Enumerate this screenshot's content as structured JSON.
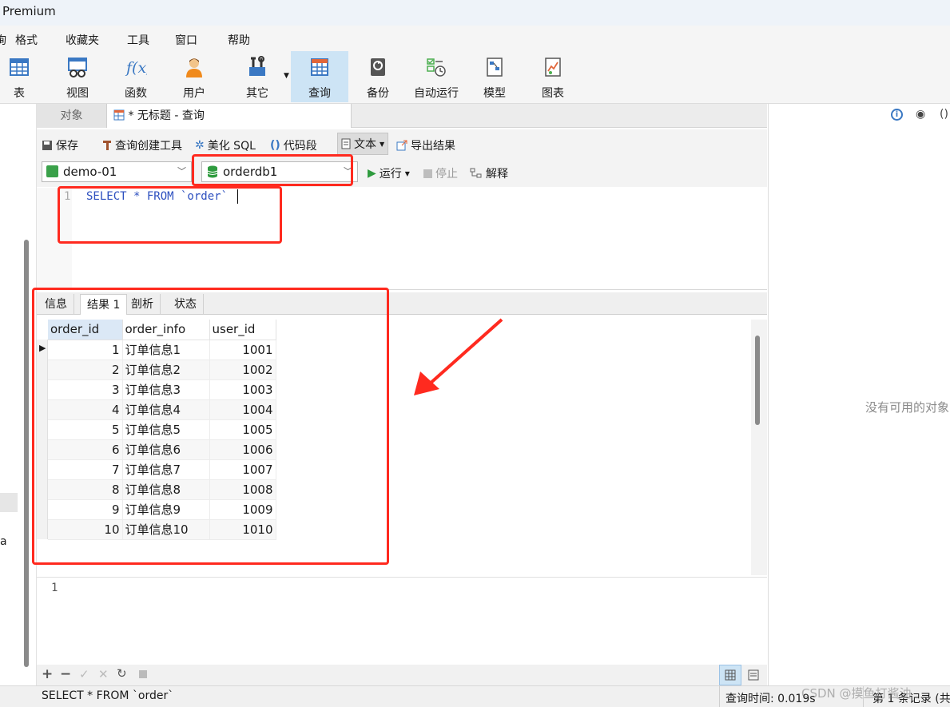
{
  "window": {
    "title": "Premium"
  },
  "menu": [
    "询",
    "格式",
    "收藏夹",
    "工具",
    "窗口",
    "帮助"
  ],
  "toolbar": [
    "表",
    "视图",
    "函数",
    "用户",
    "其它",
    "查询",
    "备份",
    "自动运行",
    "模型",
    "图表"
  ],
  "tabs": {
    "objects": "对象",
    "query": "* 无标题 - 查询"
  },
  "query_toolbar": {
    "save": "保存",
    "builder": "查询创建工具",
    "beautify": "美化 SQL",
    "snippet": "代码段",
    "text": "文本",
    "export": "导出结果"
  },
  "selectors": {
    "connection": "demo-01",
    "database": "orderdb1",
    "run": "运行",
    "stop": "停止",
    "explain": "解释"
  },
  "editor": {
    "line": "1",
    "sql": "SELECT * FROM `order`"
  },
  "result_tabs": [
    "信息",
    "结果 1",
    "剖析",
    "状态"
  ],
  "table": {
    "columns": [
      "order_id",
      "order_info",
      "user_id"
    ],
    "rows": [
      [
        "1",
        "订单信息1",
        "1001"
      ],
      [
        "2",
        "订单信息2",
        "1002"
      ],
      [
        "3",
        "订单信息3",
        "1003"
      ],
      [
        "4",
        "订单信息4",
        "1004"
      ],
      [
        "5",
        "订单信息5",
        "1005"
      ],
      [
        "6",
        "订单信息6",
        "1006"
      ],
      [
        "7",
        "订单信息7",
        "1007"
      ],
      [
        "8",
        "订单信息8",
        "1008"
      ],
      [
        "9",
        "订单信息9",
        "1009"
      ],
      [
        "10",
        "订单信息10",
        "1010"
      ]
    ]
  },
  "message_line": "1",
  "status": {
    "sql": "SELECT * FROM `order`",
    "time": "查询时间: 0.019s",
    "records": "第 1 条记录 (共",
    "watermark": "CSDN @摸鱼打酱油"
  },
  "right_pane": {
    "empty": "没有可用的对象"
  },
  "left_pane": {
    "fragment": "a"
  },
  "colors": {
    "annotation": "#ff2a1f",
    "accent": "#cde4f5"
  }
}
